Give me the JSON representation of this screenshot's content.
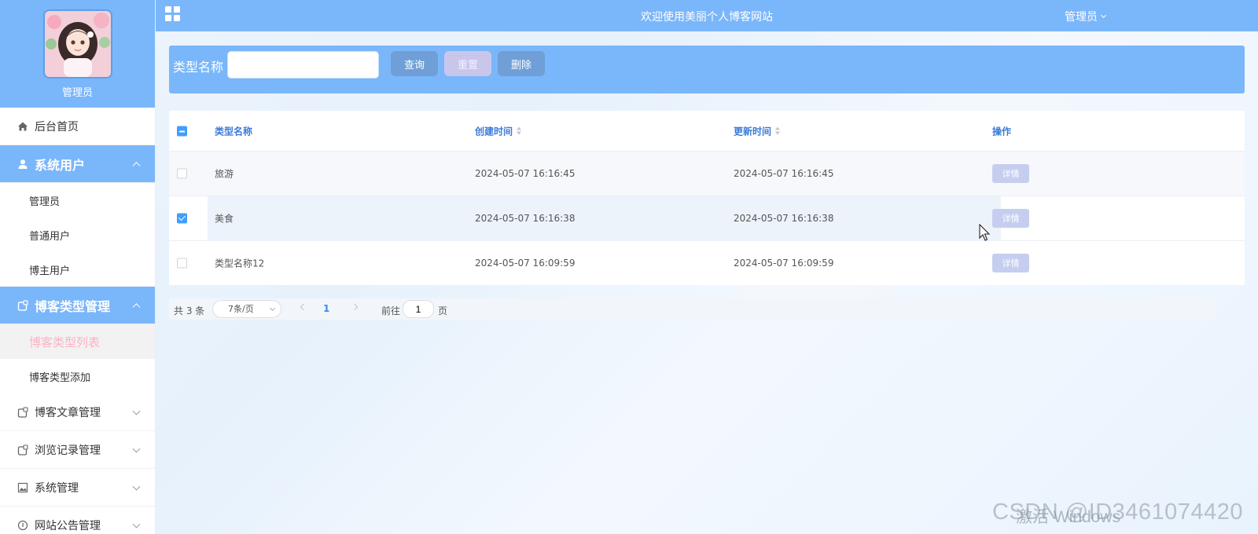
{
  "sidebar": {
    "profile_name": "管理员",
    "menu": {
      "home": "后台首页",
      "system_users": "系统用户",
      "admin": "管理员",
      "normal_user": "普通用户",
      "blogger": "博主用户",
      "blog_type_mgmt": "博客类型管理",
      "blog_type_list": "博客类型列表",
      "blog_type_add": "博客类型添加",
      "blog_article_mgmt": "博客文章管理",
      "browse_record_mgmt": "浏览记录管理",
      "system_mgmt": "系统管理",
      "site_notice_mgmt": "网站公告管理"
    }
  },
  "topbar": {
    "title": "欢迎使用美丽个人博客网站",
    "user": "管理员"
  },
  "search": {
    "label": "类型名称",
    "value": "",
    "query_label": "查询",
    "reset_label": "重置",
    "delete_label": "删除"
  },
  "table": {
    "columns": [
      "类型名称",
      "创建时间",
      "更新时间",
      "操作"
    ],
    "rows": [
      {
        "name": "旅游",
        "created": "2024-05-07 16:16:45",
        "updated": "2024-05-07 16:16:45",
        "action": "详情",
        "checked": false
      },
      {
        "name": "美食",
        "created": "2024-05-07 16:16:38",
        "updated": "2024-05-07 16:16:38",
        "action": "详情",
        "checked": true
      },
      {
        "name": "类型名称12",
        "created": "2024-05-07 16:09:59",
        "updated": "2024-05-07 16:09:59",
        "action": "详情",
        "checked": false
      }
    ]
  },
  "pagination": {
    "total": "共 3 条",
    "page_size": "7条/页",
    "current_page": "1",
    "goto_label": "前往",
    "goto_value": "1",
    "page_suffix": "页"
  },
  "watermark": {
    "windows": "激活 Windows",
    "csdn": "CSDN @ID3461074420"
  },
  "colors": {
    "primary": "#7ab6fa",
    "button": "#6f9fd6",
    "reset_button": "#c9c6ec",
    "active_subitem_text": "#ffb1c1",
    "header_text": "#3b7bd6"
  }
}
